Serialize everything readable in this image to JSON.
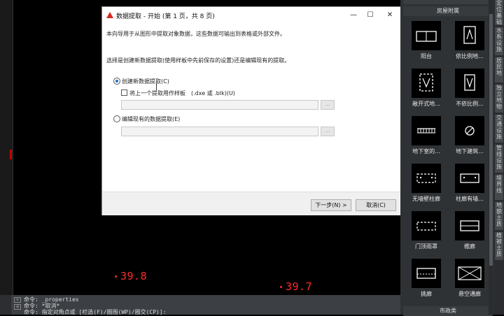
{
  "canvas": {
    "values": [
      "39.8",
      "39.7"
    ]
  },
  "command": {
    "lines": [
      "命令: _properties",
      "命令: *取消*",
      "命令: 指定对角点或 [栏选(F)/圈围(WP)/圈交(CP)]:"
    ]
  },
  "dialog": {
    "title": "数据提取 - 开始 (第 1 页，共 8 页)",
    "intro": "本向导用于从图形中提取对象数据，这些数据可输出到表格或外部文件。",
    "question": "选择是创建新数据提取(使用样板中先前保存的设置)还是编辑现有的提取。",
    "option_create": "创建新数据提取(C)",
    "use_template": "将上一个提取用作样板　(.dxe 或 .blk)(U)",
    "option_edit": "编辑现有的数据提取(E)",
    "browse": "...",
    "next": "下一步(N) >",
    "cancel": "取消(C)",
    "minimize": "—",
    "maximize": "☐",
    "close": "✕"
  },
  "palette": {
    "section": "房屋附属",
    "bottom": "市政类",
    "items": [
      {
        "label": "阳台",
        "icon": "balcony-icon"
      },
      {
        "label": "依比例地...",
        "icon": "scaled-ground-icon"
      },
      {
        "label": "敞开式地...",
        "icon": "open-ground-icon"
      },
      {
        "label": "不依比例...",
        "icon": "unscaled-icon"
      },
      {
        "label": "地下室的...",
        "icon": "basement-icon"
      },
      {
        "label": "地下建筑...",
        "icon": "underground-icon"
      },
      {
        "label": "无墙壁柱廊",
        "icon": "colonnade-icon"
      },
      {
        "label": "柱廊有墙...",
        "icon": "walled-colonnade-icon"
      },
      {
        "label": "门顶雨罩",
        "icon": "canopy-icon"
      },
      {
        "label": "檐廊",
        "icon": "veranda-icon"
      },
      {
        "label": "挑廊",
        "icon": "overhang-icon"
      },
      {
        "label": "悬空通廊",
        "icon": "skyway-icon"
      }
    ],
    "tabs": [
      "定位基础",
      "水系设施",
      "居民地",
      "独立地物",
      "交通设施",
      "管线设施",
      "境界线",
      "地貌土质",
      "植被土质"
    ]
  }
}
